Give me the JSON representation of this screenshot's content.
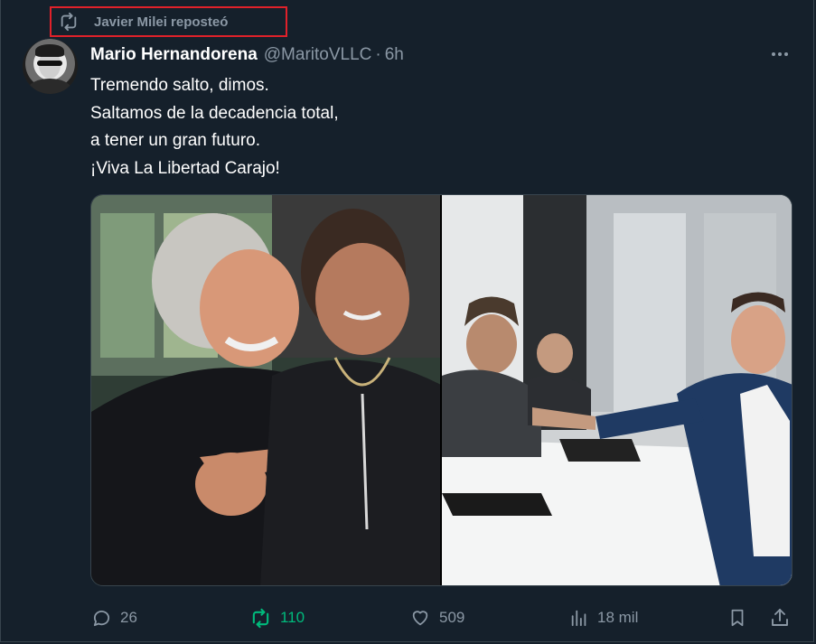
{
  "repost": {
    "label": "Javier Milei reposteó"
  },
  "tweet": {
    "author_name": "Mario Hernandorena",
    "handle": "@MaritoVLLC",
    "separator": "·",
    "time": "6h",
    "text_lines": [
      "Tremendo salto, dimos.",
      "Saltamos de la decadencia total,",
      "a tener un gran futuro.",
      "¡Viva La Libertad Carajo!"
    ]
  },
  "actions": {
    "replies": "26",
    "reposts": "110",
    "likes": "509",
    "views": "18 mil"
  },
  "colors": {
    "background": "#15202b",
    "secondary_text": "#8b98a5",
    "repost_active": "#00ba7c",
    "highlight_border": "#e0212a"
  },
  "icons": [
    "repost-icon",
    "more-icon",
    "reply-icon",
    "like-icon",
    "views-icon",
    "bookmark-icon",
    "share-icon"
  ]
}
